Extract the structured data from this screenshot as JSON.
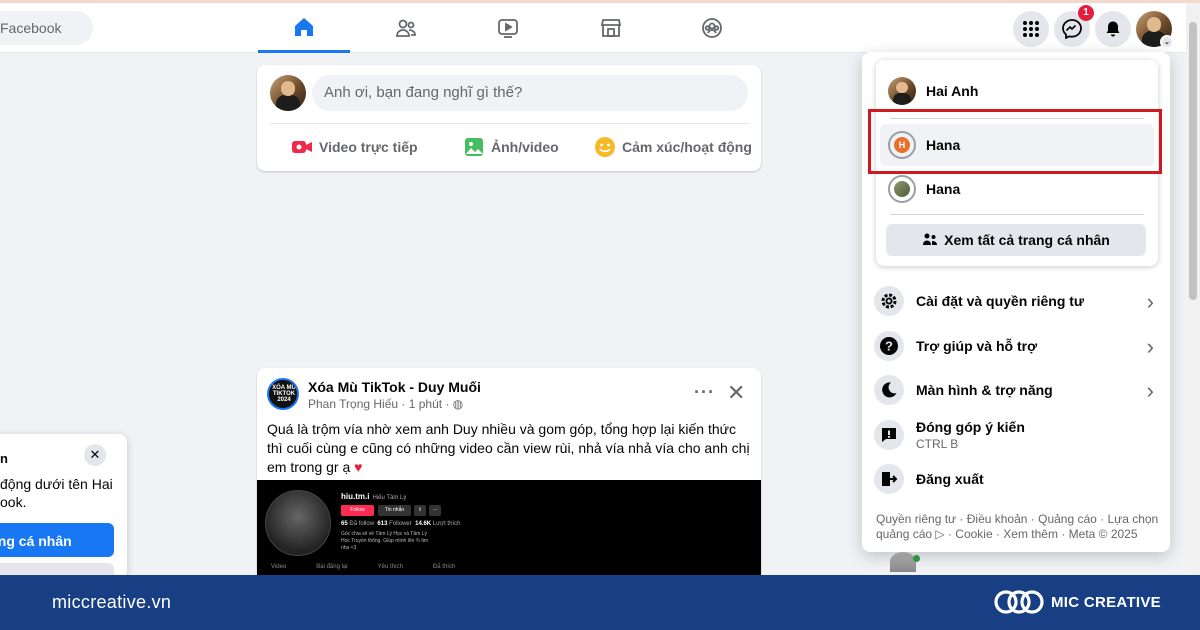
{
  "header": {
    "search_placeholder": "Facebook",
    "tabs": [
      "home-icon",
      "friends-icon",
      "watch-icon",
      "marketplace-icon",
      "groups-icon"
    ],
    "messenger_badge": "1"
  },
  "composer": {
    "placeholder": "Anh ơi, bạn đang nghĩ gì thế?",
    "actions": {
      "live": "Video trực tiếp",
      "photo": "Ảnh/video",
      "feeling": "Cảm xúc/hoạt động"
    }
  },
  "post": {
    "avatar_text": "XÓA MÙ TIKTOK 2024",
    "title": "Xóa Mù TikTok - Duy Muối",
    "author": "Phan Trọng Hiếu",
    "time": "1 phút",
    "body": "Quá là trộm vía nhờ xem anh Duy nhiều và gom góp, tổng hợp lại kiến thức thì cuối cùng e cũng có những video cần view rùi, nhả vía nhả vía cho anh chị em trong gr ạ",
    "heart": "♥",
    "media": {
      "username": "hiu.tm.i",
      "display_name": "Hiếu Tâm Lý",
      "follow": "Follow",
      "message": "Tin nhắn",
      "stat_following_num": "65",
      "stat_following": "Đã follow",
      "stat_followers_num": "613",
      "stat_followers": "Follower",
      "stat_likes_num": "14.6K",
      "stat_likes": "Lượt thích",
      "bio": "Góc chia sẻ về Tâm Lý Học và Tâm Lý Học Truyền thông. Giúp mình lên ¾ tim nha <3",
      "tabs": [
        "Video",
        "Bài đăng lại",
        "Yêu thích",
        "Đã thích"
      ]
    }
  },
  "toast": {
    "title": "n",
    "body": "động dưới tên Hai ook.",
    "button": "ang cá nhân"
  },
  "account_menu": {
    "profiles": [
      {
        "name": "Hai Anh"
      },
      {
        "name": "Hana",
        "initial": "H"
      },
      {
        "name": "Hana"
      }
    ],
    "see_all": "Xem tất cả trang cá nhân",
    "items": {
      "settings": "Cài đặt và quyền riêng tư",
      "help": "Trợ giúp và hỗ trợ",
      "display": "Màn hình & trợ năng",
      "feedback": "Đóng góp ý kiến",
      "feedback_shortcut": "CTRL B",
      "logout": "Đăng xuất"
    },
    "footer": "Quyền riêng tư · Điều khoản · Quảng cáo · Lựa chọn quảng cáo ▷ · Cookie · Xem thêm · Meta © 2025"
  },
  "branding": {
    "site": "miccreative.vn",
    "name": "MIC CREATIVE"
  },
  "colors": {
    "accent": "#1877f2",
    "highlight": "#d0191f",
    "brand_bar": "#183f84"
  }
}
